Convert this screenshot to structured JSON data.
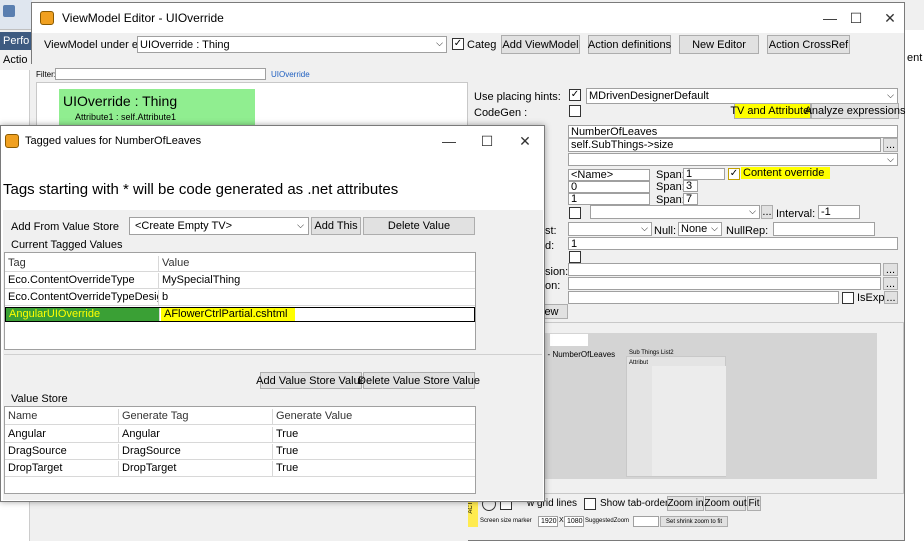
{
  "background": {
    "left_tabs": [
      "Perfo",
      "Actio"
    ]
  },
  "viewmodel_editor": {
    "title": "ViewModel Editor - UIOverride",
    "viewmodel_label": "ViewModel under edit:",
    "viewmodel_value": "UIOverride : Thing",
    "categ_label": "Categ",
    "categ_checked": "✓",
    "buttons": {
      "add_viewmodel": "Add ViewModel",
      "action_definitions": "Action definitions",
      "new_editor": "New Editor",
      "action_crossref": "Action CrossRef"
    },
    "filter_label": "Filter:",
    "filter_value": "",
    "filter_link": "UIOverride",
    "tree": {
      "class_title": "UIOverride : Thing",
      "attribute": "Attribute1 : self.Attribute1"
    },
    "props": {
      "use_placing_hints_label": "Use placing hints:",
      "use_placing_hints_checked": "✓",
      "placing_hint_value": "MDrivenDesignerDefault",
      "codegen_label": "CodeGen :",
      "tv_and_attributes": "TV and Attributes",
      "analyze_expressions": "Analyze expressions",
      "name_value": "NumberOfLeaves",
      "expression_value": "self.SubThings->size",
      "name_placeholder": "<Name>",
      "span_label": "Span:",
      "span_values": [
        "1",
        "3",
        "7"
      ],
      "row_values": [
        "0",
        "1"
      ],
      "content_override_label": "Content override",
      "content_override_checked": "✓",
      "interval_label": "Interval:",
      "interval_value": "-1",
      "null_label": "Null:",
      "null_value": "None",
      "nullrep_label": "NullRep:",
      "field_value_1": "1",
      "partial_labels": [
        "st:",
        "d:",
        "sion:",
        "on:"
      ],
      "isexp_label": "IsExp",
      "ellipsis": "...",
      "view_btn": "iew"
    },
    "preview": {
      "section_label": "E - NumberOfLeaves",
      "sub_title": "Sub Things List2",
      "sub_attr": "Attribut"
    },
    "bottom": {
      "grid_lines_label": "w grid lines",
      "show_tab_order": "Show tab-order",
      "zoom_in": "Zoom in",
      "zoom_out": "Zoom out",
      "fit": "Fit",
      "screen_size_label": "Screen size marker",
      "width": "1920",
      "x": "X",
      "height": "1080",
      "suggested_zoom": "SuggestedZoom",
      "set_shrink": "Set shrink zoom to fit",
      "acti": "ACTI"
    }
  },
  "tagged_dialog": {
    "title": "Tagged values for NumberOfLeaves",
    "heading": "Tags starting with * will be code generated as .net attributes",
    "add_from_label": "Add From Value Store",
    "create_empty": "<Create Empty TV>",
    "add_this": "Add This",
    "delete_value": "Delete Value",
    "current_label": "Current Tagged Values",
    "current_columns": [
      "Tag",
      "Value"
    ],
    "current_rows": [
      {
        "tag": "Eco.ContentOverrideType",
        "value": "MySpecialThing"
      },
      {
        "tag": "Eco.ContentOverrideTypeDesign",
        "value": "b"
      },
      {
        "tag": "AngularUIOverride",
        "value": "AFlowerCtrlPartial.cshtml"
      }
    ],
    "add_value_store_value": "Add Value Store Value",
    "delete_value_store_value": "Delete Value Store Value",
    "value_store_label": "Value Store",
    "store_columns": [
      "Name",
      "Generate Tag",
      "Generate Value"
    ],
    "store_rows": [
      {
        "name": "Angular",
        "tag": "Angular",
        "value": "True"
      },
      {
        "name": "DragSource",
        "tag": "DragSource",
        "value": "True"
      },
      {
        "name": "DropTarget",
        "tag": "DropTarget",
        "value": "True"
      }
    ]
  }
}
